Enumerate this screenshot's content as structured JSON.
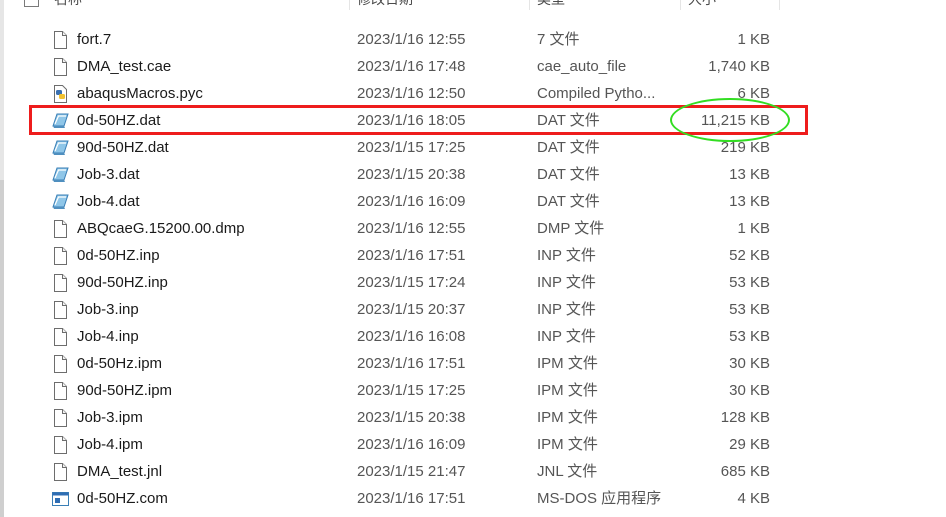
{
  "header": {
    "name": "名称",
    "date": "修改日期",
    "type": "类型",
    "size": "大小"
  },
  "files": [
    {
      "name": "fort.7",
      "date": "2023/1/16 12:55",
      "type": "7 文件",
      "size": "1 KB",
      "icon": "generic-file-icon"
    },
    {
      "name": "DMA_test.cae",
      "date": "2023/1/16 17:48",
      "type": "cae_auto_file",
      "size": "1,740 KB",
      "icon": "generic-file-icon"
    },
    {
      "name": "abaqusMacros.pyc",
      "date": "2023/1/16 12:50",
      "type": "Compiled Pytho...",
      "size": "6 KB",
      "icon": "python-file-icon"
    },
    {
      "name": "0d-50HZ.dat",
      "date": "2023/1/16 18:05",
      "type": "DAT 文件",
      "size": "11,215 KB",
      "icon": "dat-file-icon"
    },
    {
      "name": "90d-50HZ.dat",
      "date": "2023/1/15 17:25",
      "type": "DAT 文件",
      "size": "219 KB",
      "icon": "dat-file-icon"
    },
    {
      "name": "Job-3.dat",
      "date": "2023/1/15 20:38",
      "type": "DAT 文件",
      "size": "13 KB",
      "icon": "dat-file-icon"
    },
    {
      "name": "Job-4.dat",
      "date": "2023/1/16 16:09",
      "type": "DAT 文件",
      "size": "13 KB",
      "icon": "dat-file-icon"
    },
    {
      "name": "ABQcaeG.15200.00.dmp",
      "date": "2023/1/16 12:55",
      "type": "DMP 文件",
      "size": "1 KB",
      "icon": "generic-file-icon"
    },
    {
      "name": "0d-50HZ.inp",
      "date": "2023/1/16 17:51",
      "type": "INP 文件",
      "size": "52 KB",
      "icon": "generic-file-icon"
    },
    {
      "name": "90d-50HZ.inp",
      "date": "2023/1/15 17:24",
      "type": "INP 文件",
      "size": "53 KB",
      "icon": "generic-file-icon"
    },
    {
      "name": "Job-3.inp",
      "date": "2023/1/15 20:37",
      "type": "INP 文件",
      "size": "53 KB",
      "icon": "generic-file-icon"
    },
    {
      "name": "Job-4.inp",
      "date": "2023/1/16 16:08",
      "type": "INP 文件",
      "size": "53 KB",
      "icon": "generic-file-icon"
    },
    {
      "name": "0d-50Hz.ipm",
      "date": "2023/1/16 17:51",
      "type": "IPM 文件",
      "size": "30 KB",
      "icon": "generic-file-icon"
    },
    {
      "name": "90d-50HZ.ipm",
      "date": "2023/1/15 17:25",
      "type": "IPM 文件",
      "size": "30 KB",
      "icon": "generic-file-icon"
    },
    {
      "name": "Job-3.ipm",
      "date": "2023/1/15 20:38",
      "type": "IPM 文件",
      "size": "128 KB",
      "icon": "generic-file-icon"
    },
    {
      "name": "Job-4.ipm",
      "date": "2023/1/16 16:09",
      "type": "IPM 文件",
      "size": "29 KB",
      "icon": "generic-file-icon"
    },
    {
      "name": "DMA_test.jnl",
      "date": "2023/1/15 21:47",
      "type": "JNL 文件",
      "size": "685 KB",
      "icon": "generic-file-icon"
    },
    {
      "name": "0d-50HZ.com",
      "date": "2023/1/16 17:51",
      "type": "MS-DOS 应用程序",
      "size": "4 KB",
      "icon": "msdos-app-icon"
    }
  ],
  "annotations": {
    "highlight_row_color": "#ee1c1c",
    "highlight_size_color": "#33dd22"
  }
}
